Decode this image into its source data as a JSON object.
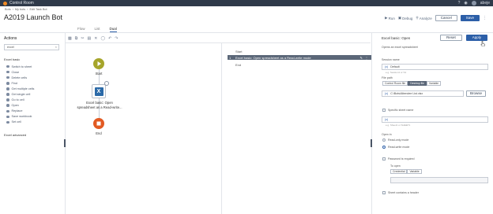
{
  "app": {
    "name": "Control Room",
    "user": "abeje"
  },
  "header": {
    "breadcrumbs": [
      "Bots",
      "My bots",
      "Edit Task Bot"
    ],
    "title": "A2019 Launch Bot",
    "run_label": "Run",
    "debug_label": "Debug",
    "analyze_label": "Analyze",
    "cancel_label": "Cancel",
    "save_label": "Save"
  },
  "view_tabs": [
    "Flow",
    "List",
    "Dual"
  ],
  "actions_pane": {
    "title": "Actions",
    "search_value": "excel",
    "group_basic": "Excel basic",
    "items": [
      "Switch to sheet",
      "Close",
      "Delete cells",
      "Find",
      "Get multiple cells",
      "Get single cell",
      "Go to cell",
      "Open",
      "Replace",
      "Save workbook",
      "Set cell"
    ],
    "group_advanced": "Excel advanced"
  },
  "flow": {
    "start_label": "Start",
    "node_title": "Excel basic: Open",
    "node_subtitle": "spreadsheet as a Read-write...",
    "end_label": "End"
  },
  "list": [
    {
      "num": "",
      "text": "Start",
      "selected": false
    },
    {
      "num": "1",
      "text": "Excel basic: Open spreadsheet as a Read-write mode",
      "selected": true
    },
    {
      "num": "",
      "text": "End",
      "selected": false
    }
  ],
  "panel": {
    "title": "Excel basic: Open",
    "reset_label": "Reset",
    "apply_label": "Apply",
    "subtitle": "Opens an excel spreadsheet",
    "session_label": "Session name",
    "session_value": "Default",
    "session_hint": "e.g. Session1 or S1",
    "filepath_label": "File path",
    "file_options": [
      "Control Room file",
      "Desktop file",
      "Variable"
    ],
    "file_selected": "Desktop file",
    "filepath_value": "C:\\Bots\\Attendee List.xlsx",
    "browse_label": "Browse",
    "sheet_check_label": "Specific sheet name",
    "sheet_hint": "e.g. Sheet1 or SHEET1",
    "open_in_label": "Open in",
    "open_modes": [
      "Read-only mode",
      "Read-write mode"
    ],
    "open_mode_selected": "Read-write mode",
    "password_label": "Password is required",
    "to_open_label": "To open",
    "credential_options": [
      "Credential",
      "Variable"
    ],
    "header_label": "Sheet contains a header"
  },
  "colors": {
    "start_node": "#a6a52b",
    "end_node": "#e25a22",
    "excel_blue": "#2b6aa8",
    "primary": "#2c5fa8"
  }
}
